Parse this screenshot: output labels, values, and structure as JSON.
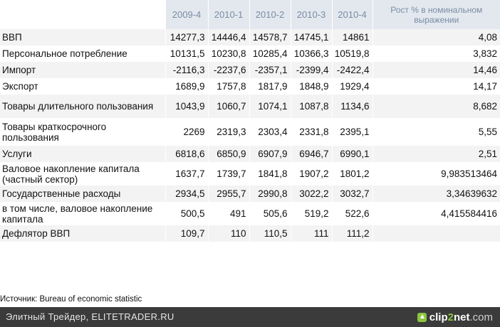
{
  "table": {
    "headers": [
      "2009-4",
      "2010-1",
      "2010-2",
      "2010-3",
      "2010-4",
      "Рост % в номинальном выражении"
    ],
    "rows": [
      {
        "label": "ВВП",
        "values": [
          "14277,3",
          "14446,4",
          "14578,7",
          "14745,1",
          "14861"
        ],
        "pct": "4,08"
      },
      {
        "label": "Персональное потребление",
        "values": [
          "10131,5",
          "10230,8",
          "10285,4",
          "10366,3",
          "10519,8"
        ],
        "pct": "3,832"
      },
      {
        "label": "Импорт",
        "values": [
          "-2116,3",
          "-2237,6",
          "-2357,1",
          "-2399,4",
          "-2422,4"
        ],
        "pct": "14,46"
      },
      {
        "label": "Экспорт",
        "values": [
          "1689,9",
          "1757,8",
          "1817,9",
          "1848,9",
          "1929,4"
        ],
        "pct": "14,17"
      },
      {
        "label": "Товары длительного пользования",
        "values": [
          "1043,9",
          "1060,7",
          "1074,1",
          "1087,8",
          "1134,6"
        ],
        "pct": "8,682"
      },
      {
        "label": "Товары краткосрочного пользования",
        "values": [
          "2269",
          "2319,3",
          "2303,4",
          "2331,8",
          "2395,1"
        ],
        "pct": "5,55"
      },
      {
        "label": "Услуги",
        "values": [
          "6818,6",
          "6850,9",
          "6907,9",
          "6946,7",
          "6990,1"
        ],
        "pct": "2,51"
      },
      {
        "label": "Валовое накопление капитала (частный сектор)",
        "values": [
          "1637,7",
          "1739,7",
          "1841,8",
          "1907,2",
          "1801,2"
        ],
        "pct": "9,983513464"
      },
      {
        "label": "Государственные расходы",
        "values": [
          "2934,5",
          "2955,7",
          "2990,8",
          "3022,2",
          "3032,7"
        ],
        "pct": "3,34639632"
      },
      {
        "label": "в том числе, валовое накопление капитала",
        "values": [
          "500,5",
          "491",
          "505,6",
          "519,2",
          "522,6"
        ],
        "pct": "4,415584416"
      },
      {
        "label": "Дефлятор ВВП",
        "values": [
          "109,7",
          "110",
          "110,5",
          "111",
          "111,2"
        ],
        "pct": ""
      }
    ]
  },
  "source": "Источник: Bureau of economic statistic",
  "footer": {
    "text": "Элитный Трейдер, ELITETRADER.RU",
    "brand_part1": "clip",
    "brand_part2": "2",
    "brand_part3": "net",
    "brand_part4": ".com",
    "brand_icon": "upload-arrow-icon",
    "accent_color": "#8cc63f"
  }
}
